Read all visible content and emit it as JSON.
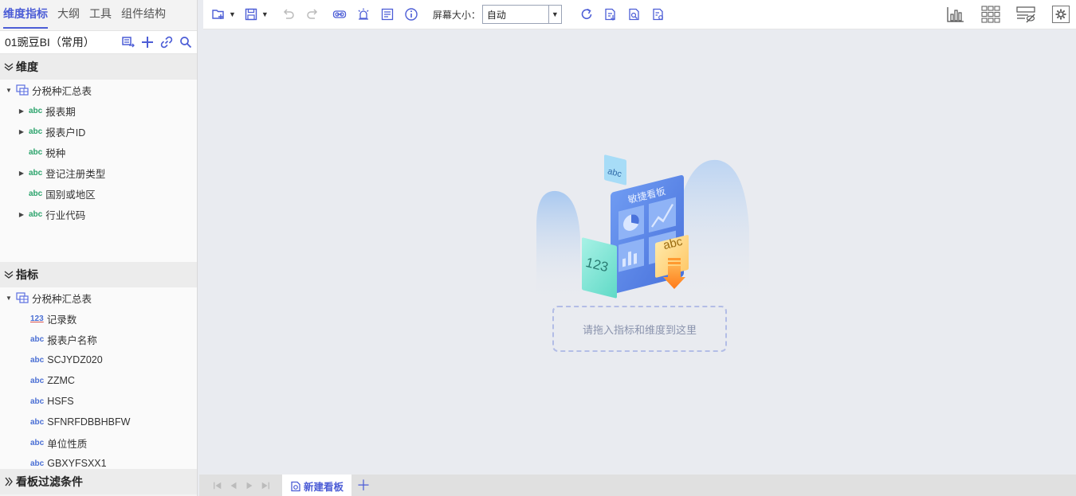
{
  "left_tabs": [
    "维度指标",
    "大纲",
    "工具",
    "组件结构"
  ],
  "source": {
    "name": "01豌豆BI（常用）"
  },
  "dimensions": {
    "title": "维度",
    "table": "分税种汇总表",
    "items": [
      {
        "type": "abc",
        "label": "报表期",
        "expandable": true
      },
      {
        "type": "abc",
        "label": "报表户ID",
        "expandable": true
      },
      {
        "type": "abc",
        "label": "税种",
        "expandable": false
      },
      {
        "type": "abc",
        "label": "登记注册类型",
        "expandable": true
      },
      {
        "type": "abc",
        "label": "国别或地区",
        "expandable": false
      },
      {
        "type": "abc",
        "label": "行业代码",
        "expandable": true
      }
    ]
  },
  "measures": {
    "title": "指标",
    "table": "分税种汇总表",
    "items": [
      {
        "type": "123",
        "label": "记录数"
      },
      {
        "type": "abc",
        "label": "报表户名称"
      },
      {
        "type": "abc",
        "label": "SCJYDZ020"
      },
      {
        "type": "abc",
        "label": "ZZMC"
      },
      {
        "type": "abc",
        "label": "HSFS"
      },
      {
        "type": "abc",
        "label": "SFNRFDBBHBFW"
      },
      {
        "type": "abc",
        "label": "单位性质"
      },
      {
        "type": "abc",
        "label": "GBXYFSXX1"
      }
    ]
  },
  "filters": {
    "title": "看板过滤条件"
  },
  "toolbar": {
    "size_label": "屏幕大小：",
    "size_value": "自动"
  },
  "canvas": {
    "board_title": "敏捷看板",
    "badge_abc": "abc",
    "badge_123": "123",
    "drop_hint": "请拖入指标和维度到这里"
  },
  "sheets": [
    {
      "label": "新建看板",
      "active": true
    }
  ],
  "colors": {
    "accent": "#4c5dd6",
    "dimension": "#2aa36b",
    "measure": "#4a6fd4"
  }
}
